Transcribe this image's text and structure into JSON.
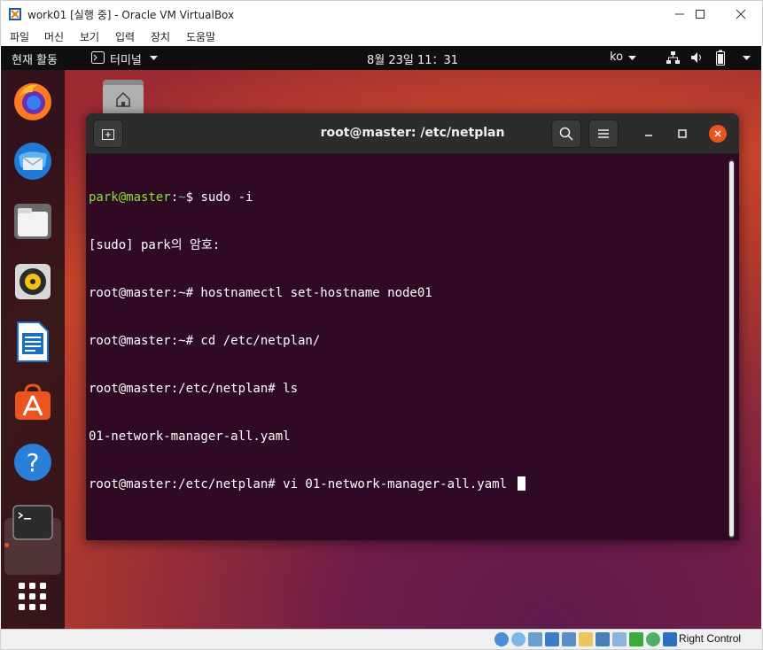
{
  "host_window": {
    "title": "work01 [실행 중] - Oracle VM VirtualBox",
    "menus": [
      "파일",
      "머신",
      "보기",
      "입력",
      "장치",
      "도움말"
    ]
  },
  "guest_topbar": {
    "activities": "현재 활동",
    "app_menu": "터미널",
    "clock": "8월 23일  11：31",
    "input_method": "ko"
  },
  "dock": {
    "apps": [
      "firefox-icon",
      "thunderbird-icon",
      "files-icon",
      "rhythmbox-icon",
      "libreoffice-writer-icon",
      "software-icon",
      "help-icon",
      "terminal-icon"
    ],
    "show_apps": "grid-icon"
  },
  "terminal": {
    "title": "root@master: /etc/netplan",
    "lines": [
      {
        "prompt_user": "park@master",
        "prompt_sep": ":",
        "prompt_path": "~",
        "prompt_end": "$ ",
        "text": "sudo -i"
      },
      {
        "text": "[sudo] park의 암호:"
      },
      {
        "text": "root@master:~# hostnamectl set-hostname node01"
      },
      {
        "text": "root@master:~# cd /etc/netplan/"
      },
      {
        "text": "root@master:/etc/netplan# ls"
      },
      {
        "text": "01-network-manager-all.yaml"
      },
      {
        "text": "root@master:/etc/netplan# vi 01-network-manager-all.yaml "
      }
    ]
  },
  "status_bar": {
    "host_key": "Right Control"
  },
  "colors": {
    "terminal_bg": "#300a24",
    "prompt_green": "#8ae234",
    "prompt_blue": "#729fcf",
    "accent_orange": "#e95420"
  }
}
